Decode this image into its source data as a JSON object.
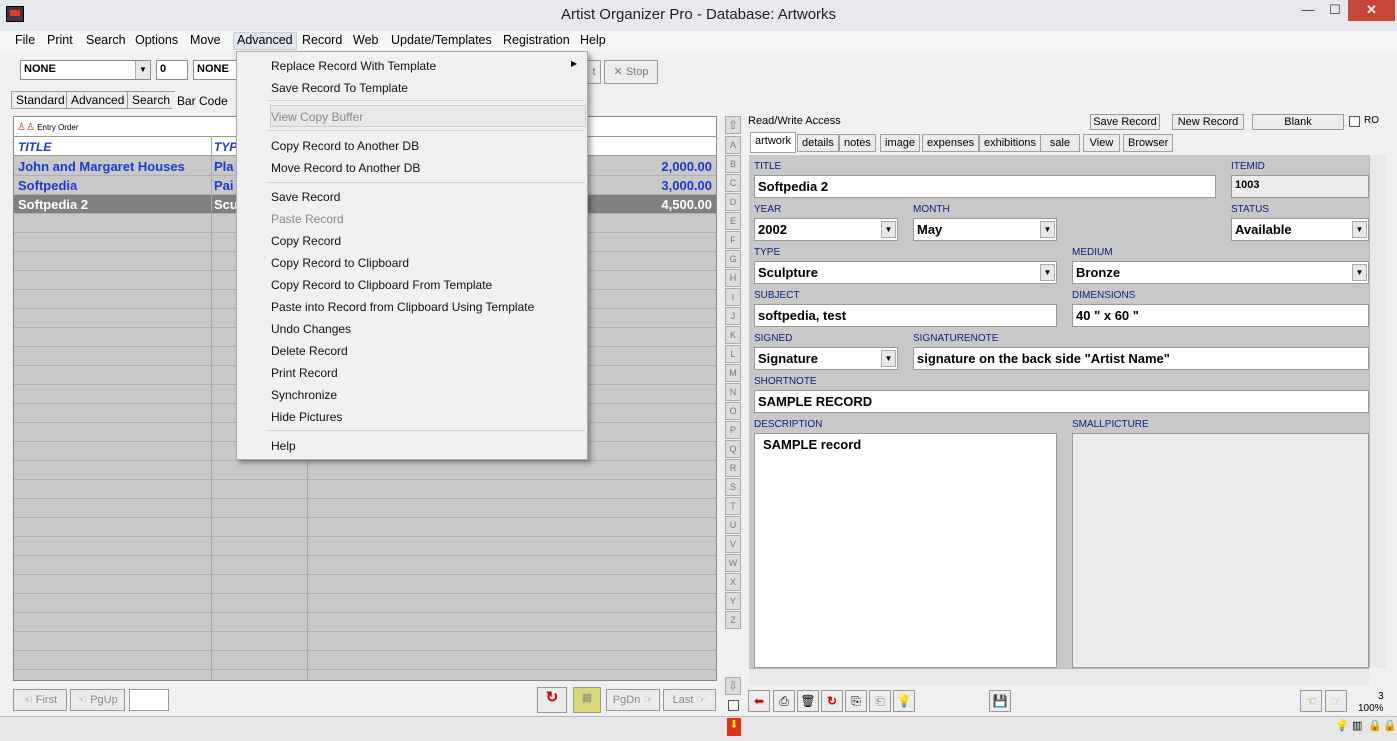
{
  "window": {
    "title": "Artist Organizer Pro - Database: Artworks",
    "minimize": "—",
    "maximize": "☐",
    "close": "✕"
  },
  "menubar": [
    "File",
    "Print",
    "Search",
    "Options",
    "Move",
    "Advanced",
    "Record",
    "Web",
    "Update/Templates",
    "Registration",
    "Help"
  ],
  "toolbar": {
    "combo1": "NONE",
    "combo2": "0",
    "combo3": "NONE",
    "partial_button": "t",
    "stop_label": "Stop"
  },
  "view_tabs": [
    "Standard",
    "Advanced",
    "Search",
    "Bar Code"
  ],
  "grid": {
    "sort_label": "Entry Order",
    "headers": [
      "TITLE",
      "TYP"
    ],
    "rows": [
      {
        "title": "John and Margaret Houses",
        "type": "Pla",
        "price": "2,000.00"
      },
      {
        "title": "Softpedia",
        "type": "Pai",
        "price": "3,000.00"
      },
      {
        "title": "Softpedia 2",
        "type": "Scu",
        "price": "4,500.00"
      }
    ]
  },
  "letters": [
    "A",
    "B",
    "C",
    "D",
    "E",
    "F",
    "G",
    "H",
    "I",
    "J",
    "K",
    "L",
    "M",
    "N",
    "O",
    "P",
    "Q",
    "R",
    "S",
    "T",
    "U",
    "V",
    "W",
    "X",
    "Y",
    "Z"
  ],
  "nav": {
    "first": "First",
    "pgup": "PgUp",
    "pgdn": "PgDn",
    "last": "Last"
  },
  "record_panel": {
    "access": "Read/Write Access",
    "save_record": "Save Record",
    "new_record": "New Record",
    "blank": "Blank",
    "ro": "RO",
    "tabs": [
      "artwork",
      "details",
      "notes",
      "image",
      "expenses",
      "exhibitions",
      "sale",
      "View",
      "Browser"
    ]
  },
  "form": {
    "title_label": "TITLE",
    "title": "Softpedia 2",
    "itemid_label": "ITEMID",
    "itemid": "1003",
    "year_label": "YEAR",
    "year": "2002",
    "month_label": "MONTH",
    "month": "May",
    "status_label": "STATUS",
    "status": "Available",
    "type_label": "TYPE",
    "type": "Sculpture",
    "medium_label": "MEDIUM",
    "medium": "Bronze",
    "subject_label": "SUBJECT",
    "subject": "softpedia, test",
    "dimensions_label": "DIMENSIONS",
    "dimensions": "40 \" x 60 \"",
    "signed_label": "SIGNED",
    "signed": "Signature",
    "signaturenote_label": "SIGNATURENOTE",
    "signaturenote": "signature on the back side \"Artist Name\"",
    "shortnote_label": "SHORTNOTE",
    "shortnote": "SAMPLE RECORD",
    "description_label": "DESCRIPTION",
    "description": "SAMPLE record",
    "smallpicture_label": "SMALLPICTURE"
  },
  "status": {
    "count": "3",
    "zoom": "100%"
  },
  "dropdown": {
    "items": [
      {
        "label": "Replace Record With Template",
        "disabled": false
      },
      {
        "label": "Save Record To Template",
        "disabled": false
      },
      {
        "label": "View Copy Buffer",
        "disabled": true
      },
      {
        "label": "Copy Record to Another DB",
        "disabled": false
      },
      {
        "label": "Move Record to Another DB",
        "disabled": false
      },
      {
        "label": "Save Record",
        "disabled": false
      },
      {
        "label": "Paste Record",
        "disabled": true
      },
      {
        "label": "Copy Record",
        "disabled": false
      },
      {
        "label": "Copy Record to Clipboard",
        "disabled": false
      },
      {
        "label": "Copy Record to Clipboard From Template",
        "disabled": false
      },
      {
        "label": "Paste into Record from Clipboard Using Template",
        "disabled": false
      },
      {
        "label": "Undo Changes",
        "disabled": false
      },
      {
        "label": "Delete Record",
        "disabled": false
      },
      {
        "label": "Print Record",
        "disabled": false
      },
      {
        "label": "Synchronize",
        "disabled": false
      },
      {
        "label": "Hide Pictures",
        "disabled": false
      },
      {
        "label": "Help",
        "disabled": false
      }
    ]
  },
  "colors": {
    "accent": "#1a3bd0",
    "selection": "#808080",
    "grid_bg": "#c8c8c8",
    "close": "#c7463a"
  }
}
